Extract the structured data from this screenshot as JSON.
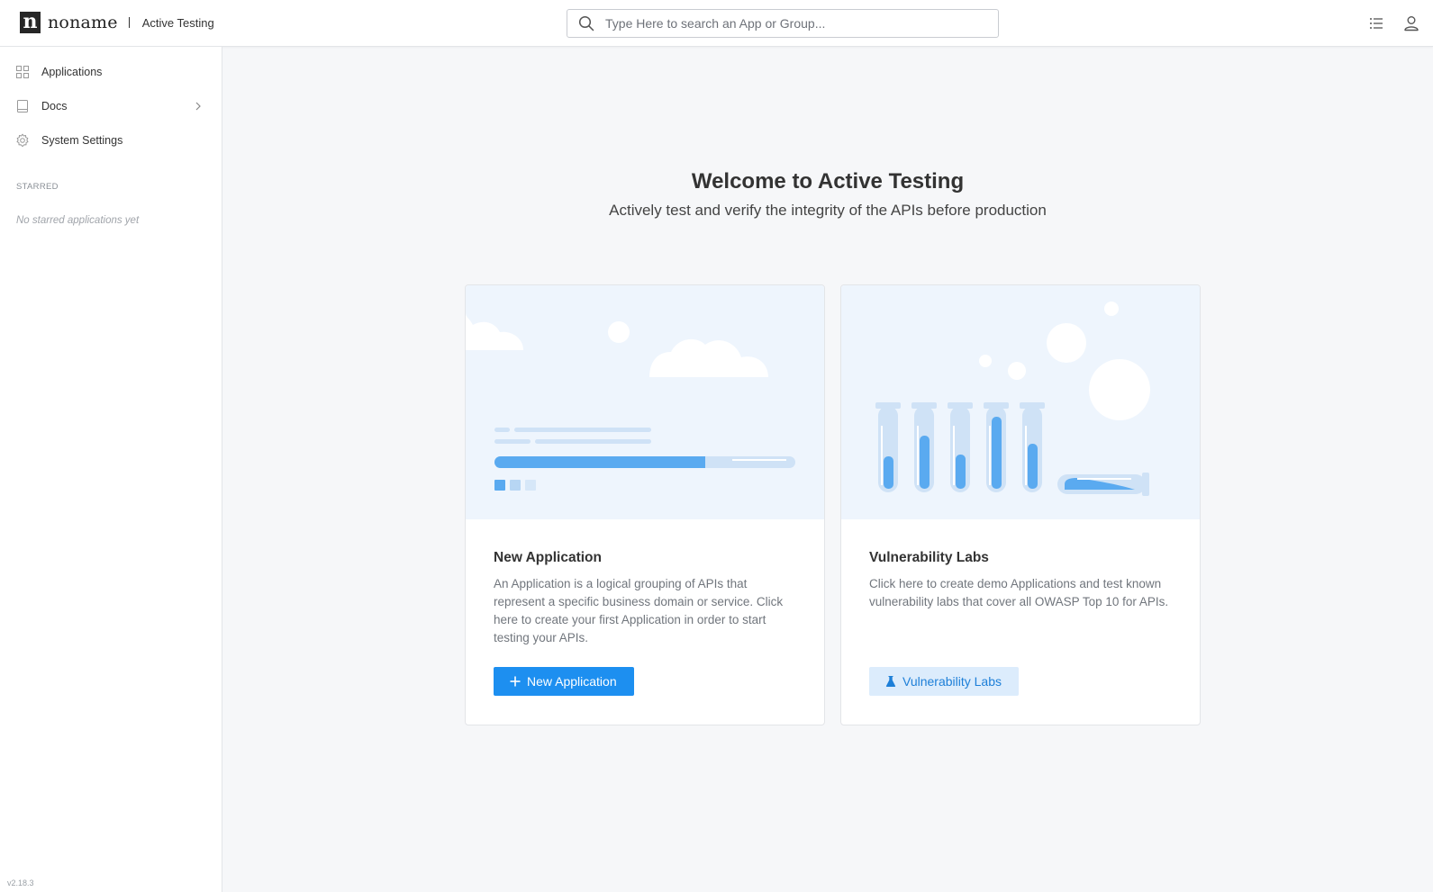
{
  "header": {
    "logo_letter": "n",
    "logo_text": "noname",
    "product_name": "Active Testing",
    "search_placeholder": "Type Here to search an App or Group...",
    "right_icons": [
      "list-icon",
      "user-icon"
    ]
  },
  "sidebar": {
    "items": [
      {
        "label": "Applications",
        "icon": "grid-icon"
      },
      {
        "label": "Docs",
        "icon": "book-icon",
        "has_submenu": true
      },
      {
        "label": "System Settings",
        "icon": "gear-icon"
      }
    ],
    "starred_title": "STARRED",
    "starred_empty": "No starred applications yet",
    "version": "v2.18.3"
  },
  "main": {
    "title": "Welcome to Active Testing",
    "subtitle": "Actively test and verify the integrity of the APIs before production",
    "cards": [
      {
        "title": "New Application",
        "description": "An Application is a logical grouping of APIs that represent a specific business domain or service. Click here to create your first Application in order to start testing your APIs.",
        "button_label": "New Application",
        "button_icon": "plus-icon"
      },
      {
        "title": "Vulnerability Labs",
        "description": "Click here to create demo Applications and test known vulnerability labs that cover all OWASP Top 10 for APIs.",
        "button_label": "Vulnerability Labs",
        "button_icon": "flask-icon"
      }
    ]
  },
  "colors": {
    "primary": "#1d8ff0",
    "primary_light": "#dcecfc",
    "illustration_bg": "#eef5fd",
    "illustration_accent": "#5aaaf0"
  }
}
